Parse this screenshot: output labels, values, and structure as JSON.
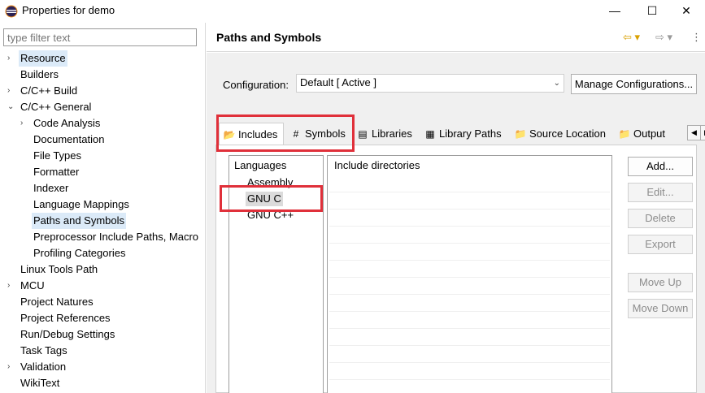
{
  "window": {
    "title": "Properties for demo",
    "minimize": "—",
    "maximize": "☐",
    "close": "✕"
  },
  "filter": {
    "placeholder": "type filter text"
  },
  "tree": [
    {
      "label": "Resource",
      "expander": "›",
      "selected": true
    },
    {
      "label": "Builders"
    },
    {
      "label": "C/C++ Build",
      "expander": "›"
    },
    {
      "label": "C/C++ General",
      "expander": "⌄"
    },
    {
      "label": "Code Analysis",
      "expander": "›"
    },
    {
      "label": "Documentation"
    },
    {
      "label": "File Types"
    },
    {
      "label": "Formatter"
    },
    {
      "label": "Indexer"
    },
    {
      "label": "Language Mappings"
    },
    {
      "label": "Paths and Symbols",
      "selected": true
    },
    {
      "label": "Preprocessor Include Paths, Macro"
    },
    {
      "label": "Profiling Categories"
    },
    {
      "label": "Linux Tools Path"
    },
    {
      "label": "MCU",
      "expander": "›"
    },
    {
      "label": "Project Natures"
    },
    {
      "label": "Project References"
    },
    {
      "label": "Run/Debug Settings"
    },
    {
      "label": "Task Tags"
    },
    {
      "label": "Validation",
      "expander": "›"
    },
    {
      "label": "WikiText"
    }
  ],
  "page": {
    "title": "Paths and Symbols",
    "nav_back": "⇦ ▾",
    "nav_forward": "⇨ ▾",
    "menu": "⋮"
  },
  "configuration": {
    "label": "Configuration:",
    "value": "Default  [ Active ]",
    "manage_button": "Manage Configurations..."
  },
  "tabs": [
    {
      "label": "Includes",
      "icon": "includes-icon",
      "glyph": "📂",
      "active": true
    },
    {
      "label": "Symbols",
      "icon": "hash-icon",
      "glyph": "#"
    },
    {
      "label": "Libraries",
      "icon": "libraries-icon",
      "glyph": "▤"
    },
    {
      "label": "Library Paths",
      "icon": "library-paths-icon",
      "glyph": "▦"
    },
    {
      "label": "Source Location",
      "icon": "folder-icon",
      "glyph": "📁"
    },
    {
      "label": "Output",
      "icon": "folder-icon",
      "glyph": "📁"
    }
  ],
  "tab_scroll": {
    "left": "◀",
    "right": "▶"
  },
  "languages": {
    "header": "Languages",
    "items": [
      "Assembly",
      "GNU C",
      "GNU C++"
    ]
  },
  "directories": {
    "header": "Include directories"
  },
  "buttons": {
    "add": "Add...",
    "edit": "Edit...",
    "delete": "Delete",
    "export": "Export",
    "move_up": "Move Up",
    "move_down": "Move Down"
  },
  "colors": {
    "selection": "#dbeaf8",
    "annotation_red": "#e0303a",
    "dialog_bg": "#f0f0f0"
  }
}
